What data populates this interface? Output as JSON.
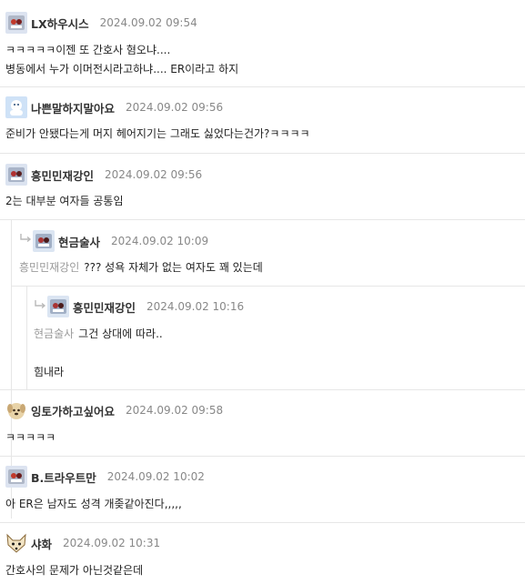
{
  "comments": [
    {
      "author": "LX하우시스",
      "date": "2024.09.02 09:54",
      "avatar": "photo-avatar",
      "lines": [
        "ㅋㅋㅋㅋㅋ이젠 또 간호사 혐오냐....",
        "병동에서 누가 이머전시라고하냐.... ER이라고 하지"
      ]
    },
    {
      "author": "나쁜말하지말아요",
      "date": "2024.09.02 09:56",
      "avatar": "blue-avatar",
      "lines": [
        "준비가 안됐다는게 머지 헤어지기는 그래도 싫었다는건가?ㅋㅋㅋㅋ"
      ]
    },
    {
      "author": "흥민민재강인",
      "date": "2024.09.02 09:56",
      "avatar": "photo-avatar",
      "lines": [
        "2는 대부분 여자들 공통임"
      ]
    },
    {
      "author": "현금술사",
      "date": "2024.09.02 10:09",
      "avatar": "photo-avatar",
      "mention": "흥민민재강인",
      "lines": [
        "??? 성욕 자체가 없는 여자도 꽤 있는데"
      ]
    },
    {
      "author": "흥민민재강인",
      "date": "2024.09.02 10:16",
      "avatar": "photo-avatar",
      "mention": "현금술사",
      "lines": [
        "그건 상대에 따라..",
        "",
        "힘내라"
      ]
    },
    {
      "author": "잉토가하고싶어요",
      "date": "2024.09.02 09:58",
      "avatar": "dog-avatar",
      "lines": [
        "ㅋㅋㅋㅋㅋ"
      ]
    },
    {
      "author": "B.트라우트만",
      "date": "2024.09.02 10:02",
      "avatar": "photo-avatar",
      "lines": [
        "아 ER은 남자도 성격 개좆같아진다,,,,,"
      ]
    },
    {
      "author": "샤화",
      "date": "2024.09.02 10:31",
      "avatar": "fox-avatar",
      "lines": [
        "간호사의 문제가 아닌것같은데"
      ]
    }
  ]
}
